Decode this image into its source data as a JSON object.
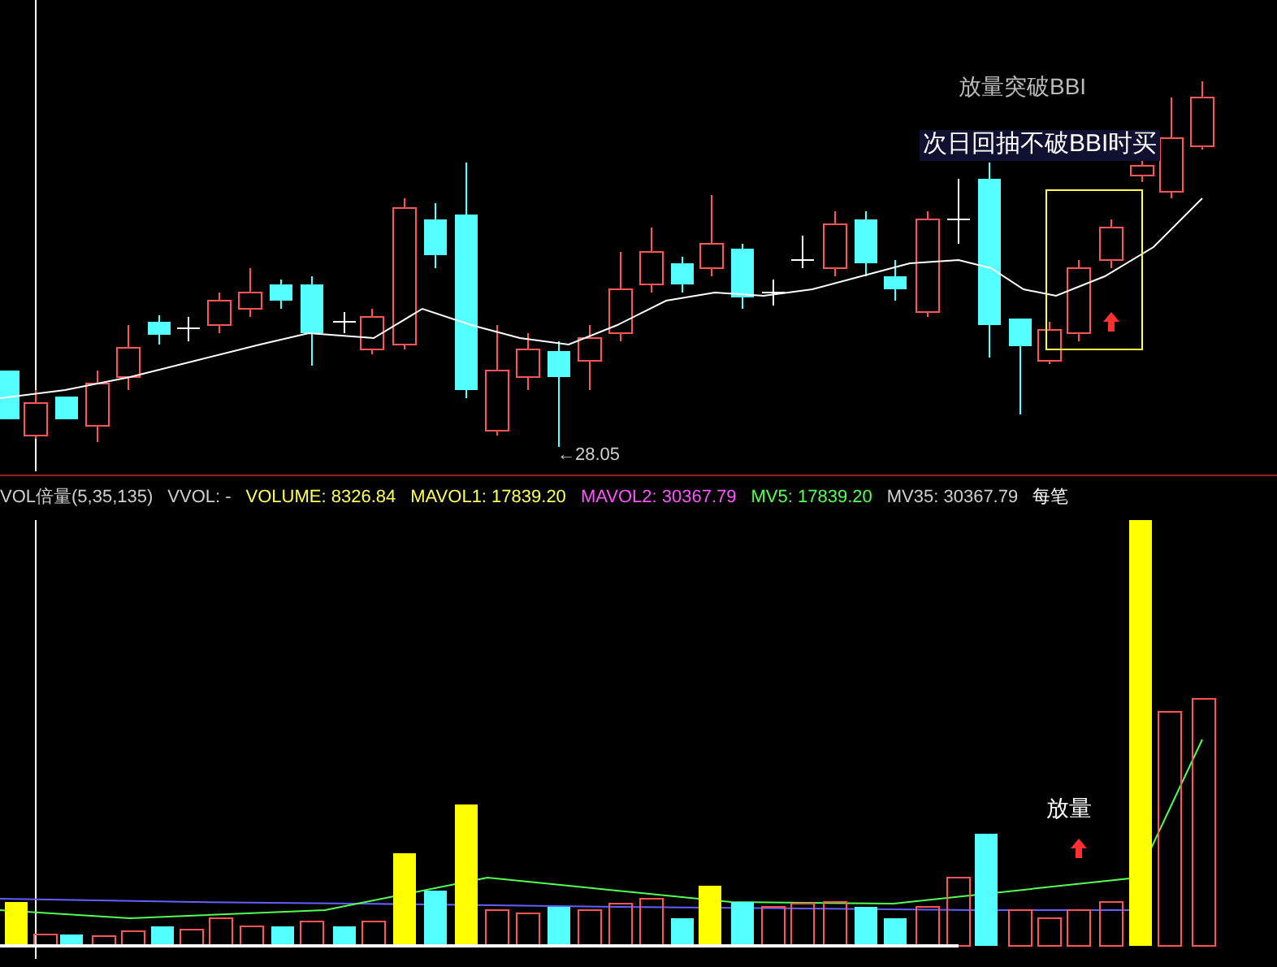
{
  "price_panel": {
    "annotations": [
      {
        "kind": "faint",
        "text": "放量突破BBI"
      },
      {
        "kind": "boxed",
        "text": "次日回抽不破BBI时买"
      }
    ],
    "low_label": "←28.05"
  },
  "indicator_legend": [
    {
      "text": "VOL倍量(5,35,135)",
      "color": "#d0d0d0"
    },
    {
      "text": "VVOL: -",
      "color": "#d0d0d0"
    },
    {
      "text": "VOLUME: 8326.84",
      "color": "#ffff54"
    },
    {
      "text": "MAVOL1: 17839.20",
      "color": "#ffff54"
    },
    {
      "text": "MAVOL2: 30367.79",
      "color": "#ff54ff"
    },
    {
      "text": "MV5: 17839.20",
      "color": "#54ff54"
    },
    {
      "text": "MV35: 30367.79",
      "color": "#d0d0d0"
    },
    {
      "text": "每笔",
      "color": "#ffffff"
    }
  ],
  "volume_panel": {
    "annotation": "放量"
  }
}
